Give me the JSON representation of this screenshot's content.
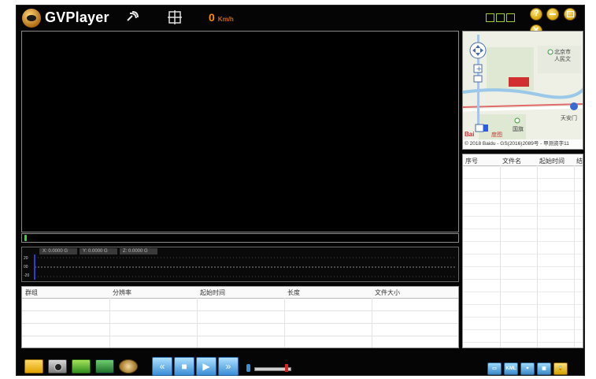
{
  "app": {
    "title": "GVPlayer"
  },
  "header": {
    "speed_value": "0",
    "speed_unit": "Km/h"
  },
  "map": {
    "labels": [
      "北京市",
      "人民文",
      "国旗",
      "天安门",
      "Bai",
      "度图"
    ],
    "copyright": "© 2018 Baidu - GS(2016)2089号 - 甲测资字11"
  },
  "gsensor": {
    "x_label": "X: 0.0000 G",
    "y_label": "Y: 0.0000 G",
    "z_label": "Z: 0.0000 G",
    "ticks": [
      "20",
      "00",
      "-20"
    ]
  },
  "filelist": {
    "columns": [
      "群组",
      "分辨率",
      "起始时间",
      "长度",
      "文件大小"
    ]
  },
  "playlist": {
    "columns": [
      "序号",
      "文件名",
      "起始时间",
      "结"
    ]
  },
  "colors": {
    "accent": "#ff8c00",
    "background": "#050505",
    "button_blue": "#3a8ed6",
    "progress_green": "#35d435"
  }
}
